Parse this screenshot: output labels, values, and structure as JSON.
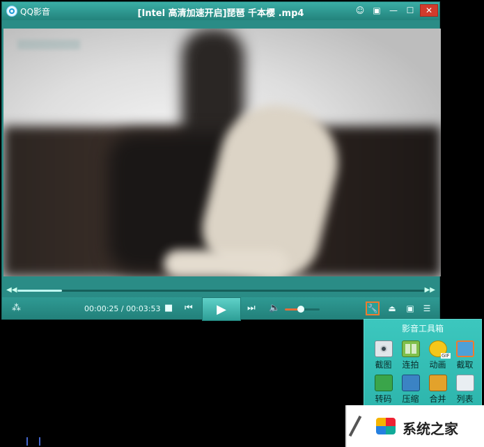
{
  "window": {
    "app_name": "QQ影音",
    "title": "[Intel 高清加速开启]琵琶 千本樱 .mp4"
  },
  "playback": {
    "current_time": "00:00:25",
    "separator": " / ",
    "total_time": "00:03:53",
    "progress": 0.11,
    "volume": 0.45
  },
  "toolbox": {
    "title": "影音工具箱",
    "tools": [
      {
        "label": "截图",
        "icon": "camera-icon"
      },
      {
        "label": "连拍",
        "icon": "burst-grid-icon"
      },
      {
        "label": "动画",
        "icon": "gif-smiley-icon"
      },
      {
        "label": "截取",
        "icon": "film-cut-icon",
        "selected": true
      },
      {
        "label": "转码",
        "icon": "convert-icon"
      },
      {
        "label": "压缩",
        "icon": "compress-icon"
      },
      {
        "label": "合并",
        "icon": "merge-icon"
      },
      {
        "label": "列表",
        "icon": "list-settings-icon"
      }
    ]
  },
  "site_watermark": {
    "text": "系统之家"
  },
  "colors": {
    "player_teal": "#2a8c86",
    "highlight_orange": "#f07b2e",
    "close_red": "#d23b2c"
  }
}
